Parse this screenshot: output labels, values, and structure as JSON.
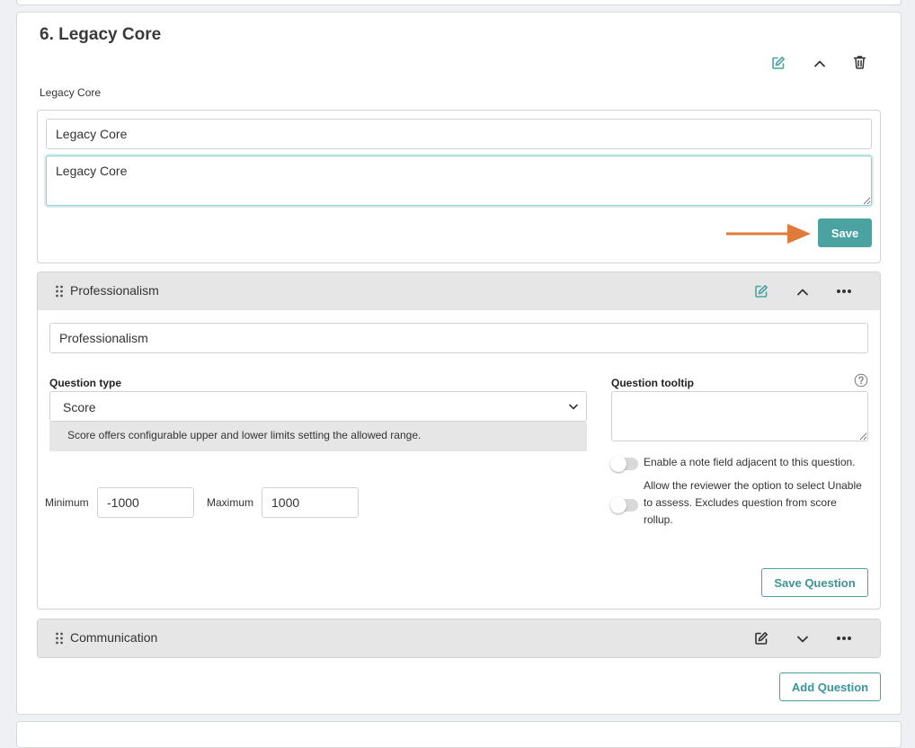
{
  "colors": {
    "accent": "#4aa3a1",
    "arrow": "#e07a3a",
    "header_bg": "#e6e6e6"
  },
  "section": {
    "title": "6. Legacy Core",
    "description": "Legacy Core",
    "icons": [
      "edit-icon",
      "chevron-up-icon",
      "trash-icon"
    ],
    "form": {
      "name_value": "Legacy Core",
      "description_value": "Legacy Core",
      "save_label": "Save"
    }
  },
  "questions": [
    {
      "title": "Professionalism",
      "expanded": true,
      "name_value": "Professionalism",
      "question_type_label": "Question type",
      "question_type_value": "Score",
      "type_hint": "Score offers configurable upper and lower limits setting the allowed range.",
      "minimum_label": "Minimum",
      "minimum_value": "-1000",
      "maximum_label": "Maximum",
      "maximum_value": "1000",
      "tooltip_label": "Question tooltip",
      "tooltip_value": "",
      "note_toggle_label": "Enable a note field adjacent to this question.",
      "unable_toggle_label": "Allow the reviewer the option to select Unable to assess. Excludes question from score rollup.",
      "save_question_label": "Save Question"
    },
    {
      "title": "Communication",
      "expanded": false
    }
  ],
  "add_question_label": "Add Question"
}
